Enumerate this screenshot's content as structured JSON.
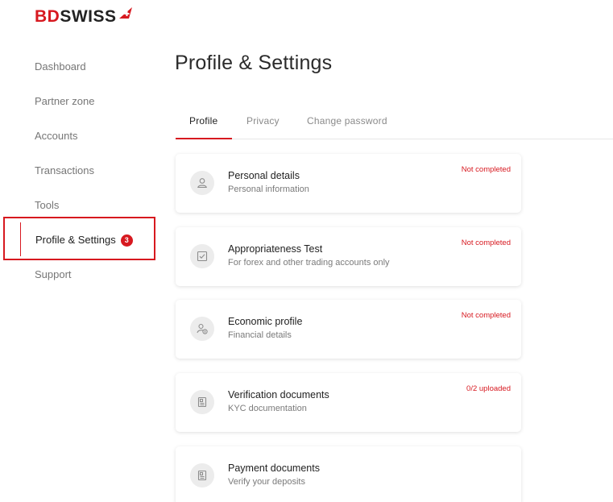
{
  "brand": {
    "part1": "BD",
    "part2": "SWISS",
    "accent_color": "#d71920"
  },
  "sidebar": {
    "items": [
      {
        "label": "Dashboard"
      },
      {
        "label": "Partner zone"
      },
      {
        "label": "Accounts"
      },
      {
        "label": "Transactions"
      },
      {
        "label": "Tools"
      },
      {
        "label": "Profile & Settings",
        "badge": "3",
        "active": true
      },
      {
        "label": "Support"
      }
    ]
  },
  "page": {
    "title": "Profile & Settings"
  },
  "tabs": [
    {
      "label": "Profile",
      "active": true
    },
    {
      "label": "Privacy"
    },
    {
      "label": "Change password"
    }
  ],
  "cards": [
    {
      "title": "Personal details",
      "subtitle": "Personal information",
      "status": "Not completed",
      "icon": "user-icon"
    },
    {
      "title": "Appropriateness Test",
      "subtitle": "For forex and other trading accounts only",
      "status": "Not completed",
      "icon": "checkbox-icon"
    },
    {
      "title": "Economic profile",
      "subtitle": "Financial details",
      "status": "Not completed",
      "icon": "user-money-icon"
    },
    {
      "title": "Verification documents",
      "subtitle": "KYC documentation",
      "status": "0/2 uploaded",
      "icon": "document-icon"
    },
    {
      "title": "Payment documents",
      "subtitle": "Verify your deposits",
      "status": "",
      "icon": "document-icon"
    }
  ]
}
